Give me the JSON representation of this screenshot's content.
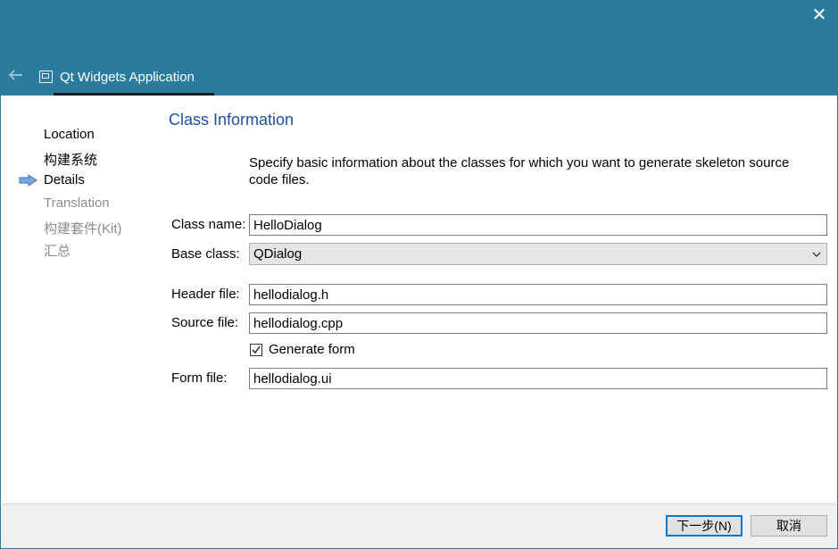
{
  "window": {
    "title": "Qt Widgets Application",
    "close_glyph": "✕",
    "back_glyph": "🡐",
    "titlebar_color": "#2b7b9e"
  },
  "steps": [
    {
      "label": "Location",
      "state": "done"
    },
    {
      "label": "构建系统",
      "state": "done"
    },
    {
      "label": "Details",
      "state": "current"
    },
    {
      "label": "Translation",
      "state": "pending"
    },
    {
      "label": "构建套件(Kit)",
      "state": "pending"
    },
    {
      "label": "汇总",
      "state": "pending"
    }
  ],
  "page": {
    "title": "Class Information",
    "description": "Specify basic information about the classes for which you want to generate skeleton source code files."
  },
  "form": {
    "class_name_label": "Class name:",
    "class_name_value": "HelloDialog",
    "base_class_label": "Base class:",
    "base_class_value": "QDialog",
    "header_file_label": "Header file:",
    "header_file_value": "hellodialog.h",
    "source_file_label": "Source file:",
    "source_file_value": "hellodialog.cpp",
    "generate_form_label": "Generate form",
    "generate_form_checked": true,
    "form_file_label": "Form file:",
    "form_file_value": "hellodialog.ui"
  },
  "footer": {
    "next_label": "下一步(N)",
    "cancel_label": "取消"
  },
  "colors": {
    "accent": "#0078d7",
    "page_title": "#1f4fa0",
    "inactive_step": "#8c8c8c"
  },
  "icons": {
    "current_step": "arrow-right-icon",
    "app": "application-window-icon",
    "close": "close-icon",
    "back": "back-arrow-icon",
    "dropdown": "chevron-down-icon",
    "checkbox": "checkmark-icon"
  }
}
